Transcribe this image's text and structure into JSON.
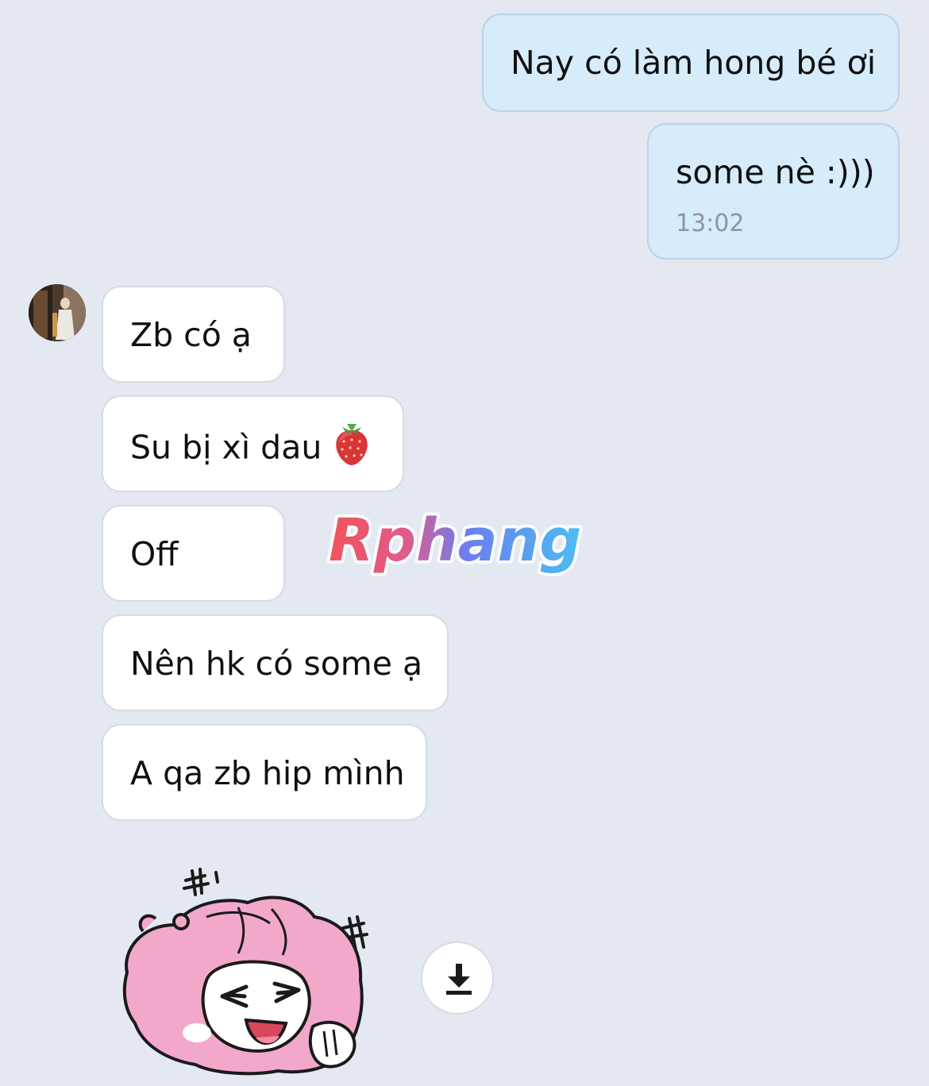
{
  "messages_out": [
    {
      "text": "Nay có làm hong bé ơi"
    },
    {
      "text": "some nè :)))",
      "time": "13:02"
    }
  ],
  "messages_in": [
    {
      "text": "Zb có ạ"
    },
    {
      "text": "Su bị xì dau",
      "emoji": "strawberry-icon"
    },
    {
      "text": "Off"
    },
    {
      "text": "Nên hk có some ạ"
    },
    {
      "text": "A qa zb hip mình"
    }
  ],
  "watermark": {
    "text": "Rphang"
  },
  "sticker": {
    "icon": "pink-blob-laughing-sticker"
  },
  "download": {
    "icon": "download-icon"
  },
  "colors": {
    "background": "#e4e8f1",
    "outgoing_bubble": "#d6ecfb",
    "incoming_bubble": "#ffffff",
    "timestamp": "#8f959d"
  }
}
